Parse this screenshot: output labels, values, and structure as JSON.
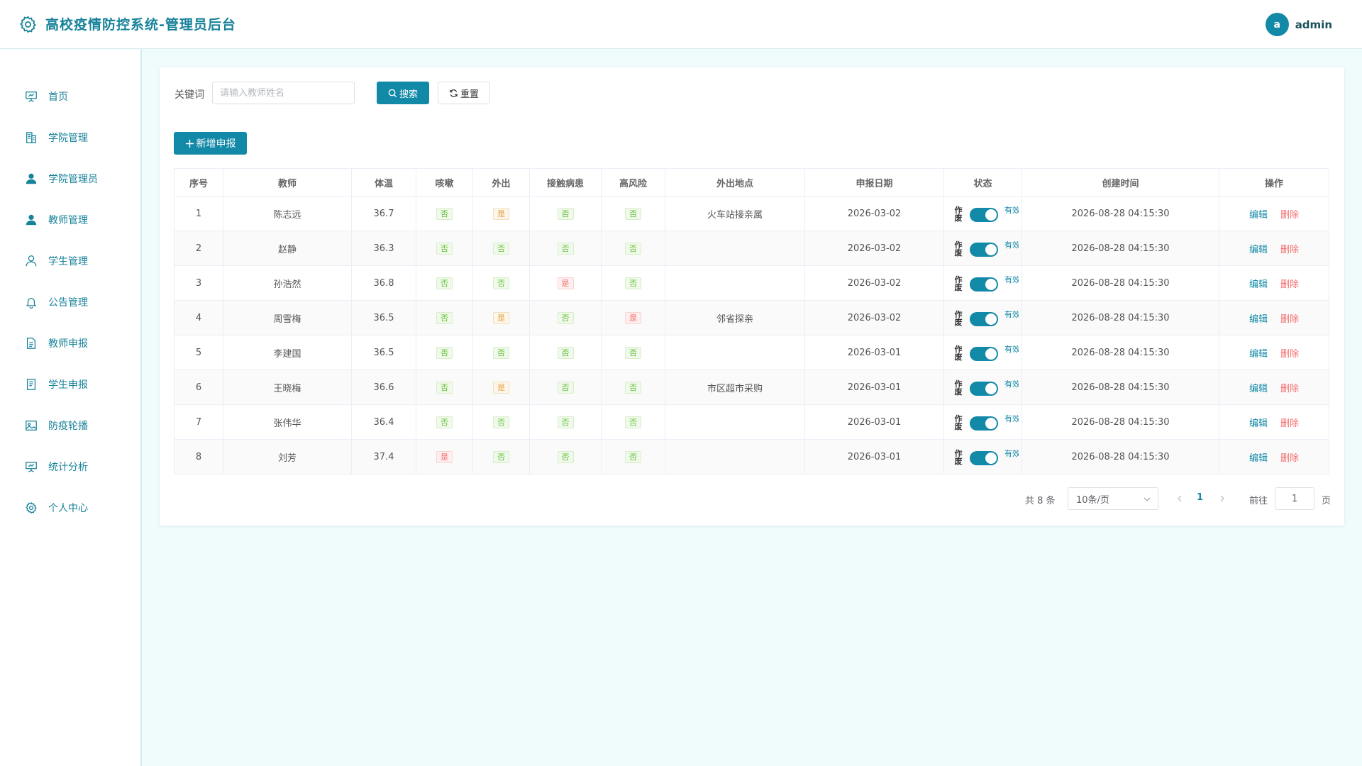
{
  "header": {
    "title": "高校疫情防控系统-管理员后台",
    "avatar_letter": "a",
    "username": "admin"
  },
  "sidebar": {
    "items": [
      {
        "label": "首页",
        "icon": "presentation-icon"
      },
      {
        "label": "学院管理",
        "icon": "building-icon"
      },
      {
        "label": "学院管理员",
        "icon": "user-filled-icon"
      },
      {
        "label": "教师管理",
        "icon": "user-filled-icon"
      },
      {
        "label": "学生管理",
        "icon": "user-outline-icon"
      },
      {
        "label": "公告管理",
        "icon": "bell-icon"
      },
      {
        "label": "教师申报",
        "icon": "document-icon"
      },
      {
        "label": "学生申报",
        "icon": "document-icon"
      },
      {
        "label": "防疫轮播",
        "icon": "picture-icon"
      },
      {
        "label": "统计分析",
        "icon": "chart-board-icon"
      },
      {
        "label": "个人中心",
        "icon": "gear-icon"
      }
    ]
  },
  "search": {
    "label": "关键词",
    "placeholder": "请输入教师姓名",
    "value": "",
    "search_label": "搜索",
    "reset_label": "重置"
  },
  "toolbar": {
    "add_label": "新增申报"
  },
  "table": {
    "columns": [
      "序号",
      "教师",
      "体温",
      "咳嗽",
      "外出",
      "接触病患",
      "高风险",
      "外出地点",
      "申报日期",
      "状态",
      "创建时间",
      "操作"
    ],
    "status_off_text": "作废",
    "status_on_text": "有效",
    "edit_label": "编辑",
    "delete_label": "删除",
    "rows": [
      {
        "no": "1",
        "teacher": "陈志远",
        "temp": "36.7",
        "cough": "否",
        "out": "是",
        "contact": "否",
        "risk": "否",
        "place": "火车站接亲属",
        "date": "2026-03-02",
        "active": true,
        "created": "2026-08-28 04:15:30"
      },
      {
        "no": "2",
        "teacher": "赵静",
        "temp": "36.3",
        "cough": "否",
        "out": "否",
        "contact": "否",
        "risk": "否",
        "place": "",
        "date": "2026-03-02",
        "active": true,
        "created": "2026-08-28 04:15:30"
      },
      {
        "no": "3",
        "teacher": "孙浩然",
        "temp": "36.8",
        "cough": "否",
        "out": "否",
        "contact": "是",
        "risk": "否",
        "place": "",
        "date": "2026-03-02",
        "active": true,
        "created": "2026-08-28 04:15:30"
      },
      {
        "no": "4",
        "teacher": "周雪梅",
        "temp": "36.5",
        "cough": "否",
        "out": "是",
        "contact": "否",
        "risk": "是",
        "place": "邻省探亲",
        "date": "2026-03-02",
        "active": true,
        "created": "2026-08-28 04:15:30"
      },
      {
        "no": "5",
        "teacher": "李建国",
        "temp": "36.5",
        "cough": "否",
        "out": "否",
        "contact": "否",
        "risk": "否",
        "place": "",
        "date": "2026-03-01",
        "active": true,
        "created": "2026-08-28 04:15:30"
      },
      {
        "no": "6",
        "teacher": "王晓梅",
        "temp": "36.6",
        "cough": "否",
        "out": "是",
        "contact": "否",
        "risk": "否",
        "place": "市区超市采购",
        "date": "2026-03-01",
        "active": true,
        "created": "2026-08-28 04:15:30"
      },
      {
        "no": "7",
        "teacher": "张伟华",
        "temp": "36.4",
        "cough": "否",
        "out": "否",
        "contact": "否",
        "risk": "否",
        "place": "",
        "date": "2026-03-01",
        "active": true,
        "created": "2026-08-28 04:15:30"
      },
      {
        "no": "8",
        "teacher": "刘芳",
        "temp": "37.4",
        "cough": "是",
        "out": "否",
        "contact": "否",
        "risk": "否",
        "place": "",
        "date": "2026-03-01",
        "active": true,
        "created": "2026-08-28 04:15:30"
      }
    ]
  },
  "pagination": {
    "total_text": "共 8 条",
    "page_size": "10条/页",
    "current_page": "1",
    "goto_prefix": "前往",
    "goto_value": "1",
    "goto_suffix": "页"
  },
  "colors": {
    "primary": "#1289a7",
    "danger": "#f56c6c",
    "warning": "#e6a23c",
    "success": "#67c23a",
    "background": "#f0fbfb"
  }
}
